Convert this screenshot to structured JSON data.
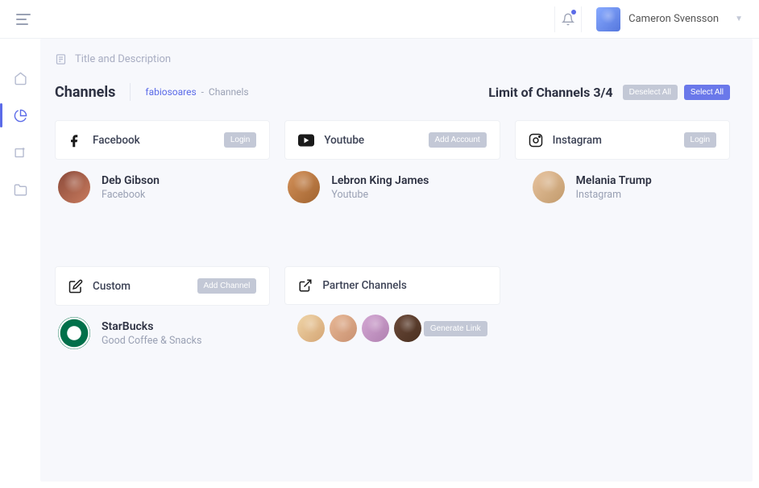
{
  "topbar": {
    "user_name": "Cameron Svensson"
  },
  "strip": {
    "label": "Title and Description"
  },
  "header": {
    "title": "Channels",
    "breadcrumb_link": "fabiosoares",
    "breadcrumb_sep": "-",
    "breadcrumb_current": "Channels",
    "limit_label": "Limit of Channels 3/4",
    "deselect": "Deselect All",
    "select": "Select All"
  },
  "cards": {
    "facebook": {
      "title": "Facebook",
      "action": "Login",
      "person": "Deb Gibson",
      "sub": "Facebook"
    },
    "youtube": {
      "title": "Youtube",
      "action": "Add Account",
      "person": "Lebron King James",
      "sub": "Youtube"
    },
    "instagram": {
      "title": "Instagram",
      "action": "Login",
      "person": "Melania Trump",
      "sub": "Instagram"
    },
    "custom": {
      "title": "Custom",
      "action": "Add Channel",
      "person": "StarBucks",
      "sub": "Good Coffee & Snacks"
    },
    "partner": {
      "title": "Partner Channels",
      "action": "Generate Link"
    }
  }
}
